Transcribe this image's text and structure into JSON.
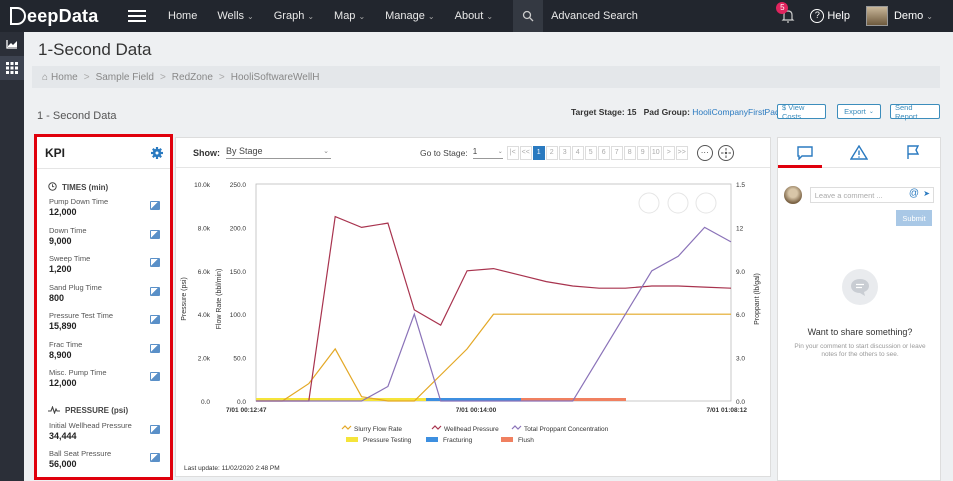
{
  "nav": {
    "logo": "DeepData",
    "items": [
      {
        "label": "Home",
        "has_menu": false
      },
      {
        "label": "Wells",
        "has_menu": true
      },
      {
        "label": "Graph",
        "has_menu": true
      },
      {
        "label": "Map",
        "has_menu": true
      },
      {
        "label": "Manage",
        "has_menu": true
      },
      {
        "label": "About",
        "has_menu": true
      }
    ],
    "advanced_search": "Advanced Search",
    "notification_count": "5",
    "help": "Help",
    "user": "Demo"
  },
  "page": {
    "title": "1-Second Data",
    "breadcrumb": [
      "Home",
      "Sample Field",
      "RedZone",
      "HooliSoftwareWellH"
    ],
    "subtitle": "1 - Second Data",
    "target_stage_label": "Target Stage:",
    "target_stage_value": "15",
    "pad_group_label": "Pad Group:",
    "pad_group_value": "HooliCompanyFirstPad",
    "btn_view_costs": "$ View Costs",
    "btn_export": "Export",
    "btn_send_report": "Send Report"
  },
  "kpi": {
    "title": "KPI",
    "sections": [
      {
        "title": "TIMES (min)",
        "icon": "clock-icon",
        "rows": [
          {
            "label": "Pump Down Time",
            "value": "12,000"
          },
          {
            "label": "Down Time",
            "value": "9,000"
          },
          {
            "label": "Sweep Time",
            "value": "1,200"
          },
          {
            "label": "Sand Plug Time",
            "value": "800"
          },
          {
            "label": "Pressure Test Time",
            "value": "15,890"
          },
          {
            "label": "Frac Time",
            "value": "8,900"
          },
          {
            "label": "Misc. Pump Time",
            "value": "12,000"
          }
        ]
      },
      {
        "title": "PRESSURE (psi)",
        "icon": "pulse-icon",
        "rows": [
          {
            "label": "Initial Wellhead Pressure",
            "value": "34,444"
          },
          {
            "label": "Ball Seat Pressure",
            "value": "56,000"
          }
        ]
      }
    ]
  },
  "toolbar": {
    "show_label": "Show:",
    "show_value": "By Stage",
    "goto_label": "Go to Stage:",
    "goto_value": "1",
    "pages": [
      "1",
      "2",
      "3",
      "4",
      "5",
      "6",
      "7",
      "8",
      "9",
      "10"
    ],
    "active_page": "1",
    "first": "|<",
    "prev": "<<",
    "next": ">",
    "last": ">>"
  },
  "chart_data": {
    "type": "line",
    "title": "",
    "x": [
      "7/01 00:12:47",
      "7/01 00:14:00",
      "7/01 01:08:12"
    ],
    "axes": {
      "pressure": {
        "label": "Pressure (psi)",
        "ticks": [
          "0.0",
          "2.0k",
          "4.0k",
          "6.0k",
          "8.0k",
          "10.0k"
        ],
        "range": [
          0,
          10000
        ]
      },
      "flow_rate": {
        "label": "Flow Rate (bbl/min)",
        "ticks": [
          "0.0",
          "50.0",
          "100.0",
          "150.0",
          "200.0",
          "250.0"
        ],
        "range": [
          0,
          250
        ]
      },
      "proppant": {
        "label": "Proppant (lb/gal)",
        "ticks": [
          "0.0",
          "3.0",
          "6.0",
          "9.0",
          "12",
          "1.5"
        ],
        "range": [
          0,
          15
        ]
      }
    },
    "series": [
      {
        "name": "Slurry Flow Rate",
        "color": "#e3a826",
        "axis": "flow_rate",
        "values": [
          0,
          0,
          20,
          60,
          5,
          0,
          0,
          30,
          60,
          100,
          100,
          100,
          100,
          100,
          100,
          100,
          100,
          100,
          100
        ]
      },
      {
        "name": "Wellhead Pressure",
        "color": "#a8334e",
        "axis": "pressure",
        "values": [
          0,
          0,
          0,
          8500,
          8000,
          8200,
          4200,
          3500,
          6000,
          6100,
          5800,
          5500,
          5300,
          5200,
          5200,
          5300,
          5300,
          5250,
          5200
        ]
      },
      {
        "name": "Total Proppant Concentration",
        "color": "#8a72b8",
        "axis": "proppant",
        "values": [
          0,
          0,
          0,
          0,
          0,
          1,
          6,
          0,
          0,
          0,
          0,
          0,
          0,
          3,
          6,
          9,
          10,
          12,
          11
        ]
      }
    ],
    "bands": [
      {
        "name": "Pressure Testing",
        "color": "#f5e43a"
      },
      {
        "name": "Fracturing",
        "color": "#3d8fe0"
      },
      {
        "name": "Flush",
        "color": "#f08060"
      }
    ],
    "legend_position": "bottom"
  },
  "last_update": "Last update: 11/02/2020 2:48 PM",
  "comments": {
    "placeholder": "Leave a comment ...",
    "submit": "Submit",
    "empty_title": "Want to share something?",
    "empty_sub": "Pin your comment to start discussion or leave notes for the others to see."
  },
  "colors": {
    "nav_bg": "#22262e",
    "accent": "#2a7ac0",
    "kpi_outline": "#e0000c"
  }
}
